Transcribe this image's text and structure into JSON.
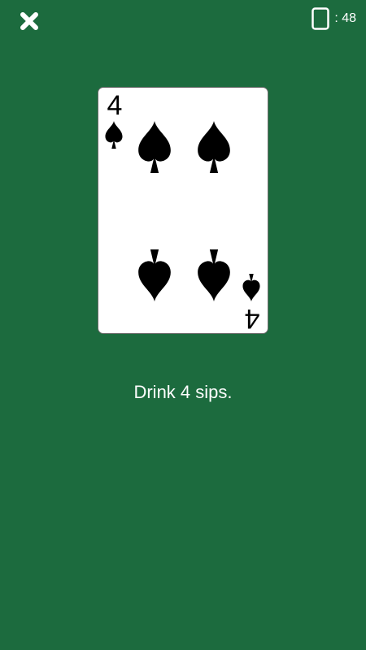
{
  "toolbar": {
    "close_icon": "close-x-icon",
    "deck_icon": "card-deck-icon",
    "cards_remaining": 48,
    "cards_remaining_label": ": 48"
  },
  "card": {
    "rank": "4",
    "suit": "spades",
    "suit_color": "#000000",
    "pips": 4
  },
  "message": "Drink 4 sips.",
  "colors": {
    "background": "#1c6b3e",
    "card_face": "#ffffff",
    "text": "#ffffff"
  }
}
